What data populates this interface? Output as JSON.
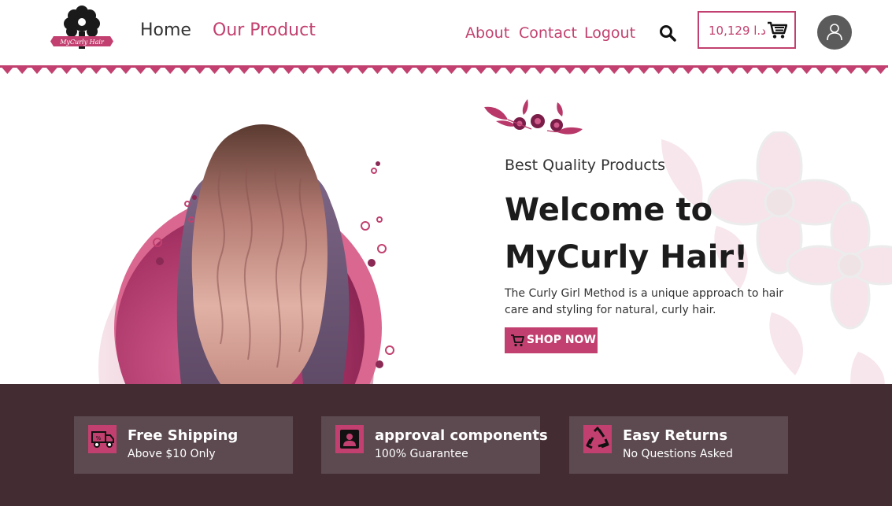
{
  "header": {
    "logo_text": "MyCurly Hair",
    "nav_left": [
      "Home",
      "Our Product"
    ],
    "nav_right": [
      "About",
      "Contact",
      "Logout"
    ],
    "cart_amount": "10,129 د.ا",
    "icons": {
      "search": "search-icon",
      "cart": "cart-icon",
      "user": "user-icon"
    }
  },
  "hero": {
    "tagline": "Best Quality Products",
    "title": "Welcome to MyCurly Hair!",
    "description": "The Curly Girl Method is a unique approach to hair care and styling for natural, curly hair.",
    "cta_label": "SHOP NOW"
  },
  "features": [
    {
      "icon": "delivery-truck-icon",
      "title": "Free Shipping",
      "subtitle": "Above $10 Only"
    },
    {
      "icon": "user-badge-icon",
      "title": "approval components",
      "subtitle": "100% Guarantee"
    },
    {
      "icon": "recycle-icon",
      "title": "Easy Returns",
      "subtitle": "No Questions Asked"
    }
  ],
  "colors": {
    "accent": "#c2406f",
    "footer_band": "#432d33",
    "feature_card": "#5c4a50",
    "avatar": "#5b5b5b"
  }
}
